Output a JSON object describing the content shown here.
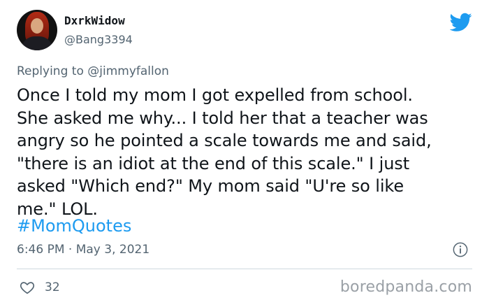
{
  "tweet": {
    "author": {
      "display_name": "DxrkWidow",
      "handle": "@Bang3394",
      "avatar_icon": "avatar-photo"
    },
    "brand_icon": "twitter-bird-icon",
    "brand_color": "#1d9bf0",
    "replying_to": {
      "prefix": "Replying to",
      "mention": "@jimmyfallon"
    },
    "body_lines": [
      "Once I told my mom I got expelled from school.",
      "She asked me why... I told her that a teacher was",
      "angry so he pointed a scale towards me and said,",
      "\"there is an idiot at the end of this scale.\" I just",
      "asked \"Which end?\" My mom said \"U're so like",
      "me.\" LOL."
    ],
    "hashtag": "#MomQuotes",
    "timestamp": "6:46 PM · May 3, 2021",
    "info_icon": "info-icon",
    "likes": "32",
    "like_icon": "heart-icon"
  },
  "watermark": "boredpanda.com"
}
